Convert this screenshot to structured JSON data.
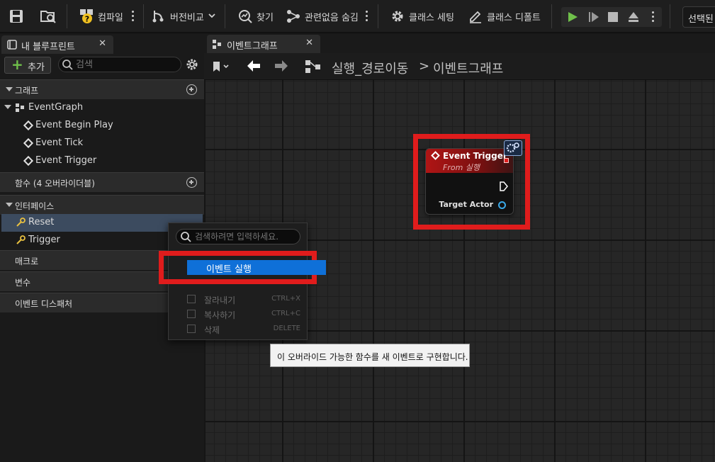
{
  "toolbar": {
    "compile_label": "컴파일",
    "diff_label": "버전비교",
    "find_label": "찾기",
    "hide_unrelated_label": "관련없음 숨김",
    "class_settings_label": "클래스 세팅",
    "class_defaults_label": "클래스 디폴트",
    "selected_label": "선택된",
    "colors": {
      "play": "#6fc04a"
    }
  },
  "left_panel": {
    "tab_title": "내 블루프린트",
    "add_label": "추가",
    "search_placeholder": "검색",
    "sections": {
      "graphs": "그래프",
      "functions": "함수 (4 오버라이더블)",
      "interfaces": "인터페이스",
      "macros": "매크로",
      "variables": "변수",
      "dispatchers": "이벤트 디스패처"
    },
    "graph_items": {
      "event_graph": "EventGraph",
      "begin_play": "Event Begin Play",
      "tick": "Event Tick",
      "trigger": "Event Trigger"
    },
    "interface_items": {
      "reset": "Reset",
      "trigger": "Trigger"
    }
  },
  "graph": {
    "tab_title": "이벤트그래프",
    "breadcrumb_parent": "실행_경로이동",
    "breadcrumb_sep": ">",
    "breadcrumb_current": "이벤트그래프"
  },
  "node": {
    "title": "Event Trigger",
    "subtitle": "From 실행",
    "pin_label": "Target Actor"
  },
  "context_menu": {
    "search_placeholder": "검색하려면 입력하세요.",
    "highlighted": "이벤트 실행",
    "items": [
      {
        "label": "잘라내기",
        "shortcut": "CTRL+X"
      },
      {
        "label": "복사하기",
        "shortcut": "CTRL+C"
      },
      {
        "label": "삭제",
        "shortcut": "DELETE"
      }
    ]
  },
  "tooltip": "이 오버라이드 가능한 함수를 새 이벤트로 구현합니다."
}
